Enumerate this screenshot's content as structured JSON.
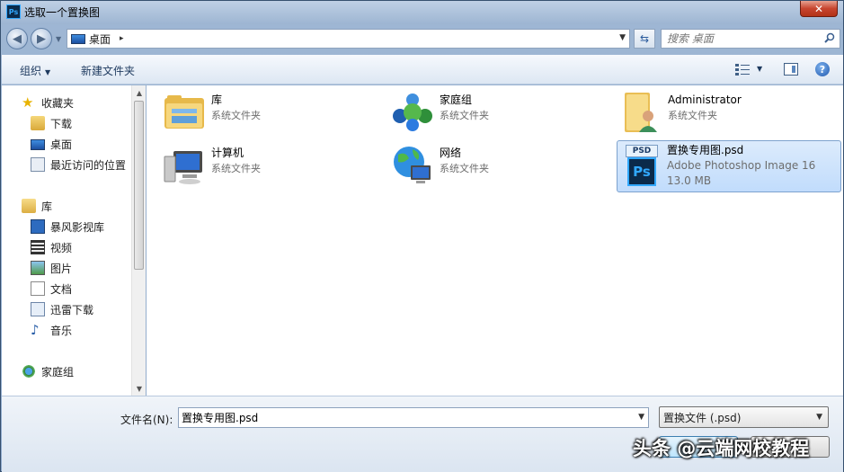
{
  "window": {
    "title": "选取一个置换图",
    "app_icon_text": "Ps",
    "close_glyph": "✕"
  },
  "address": {
    "back_glyph": "◀",
    "forward_glyph": "▶",
    "location": "桌面",
    "chevron": "▸",
    "search_placeholder": "搜索 桌面"
  },
  "toolbar": {
    "organize_label": "组织",
    "new_folder_label": "新建文件夹",
    "help_glyph": "?"
  },
  "nav": {
    "favorites_label": "收藏夹",
    "favorites": [
      "下载",
      "桌面",
      "最近访问的位置"
    ],
    "libraries_label": "库",
    "libraries": [
      "暴风影视库",
      "视频",
      "图片",
      "文档",
      "迅雷下载",
      "音乐"
    ],
    "homegroup_label": "家庭组"
  },
  "items": [
    {
      "name": "库",
      "sub": "系统文件夹"
    },
    {
      "name": "家庭组",
      "sub": "系统文件夹"
    },
    {
      "name": "Administrator",
      "sub": "系统文件夹"
    },
    {
      "name": "计算机",
      "sub": "系统文件夹"
    },
    {
      "name": "网络",
      "sub": "系统文件夹"
    },
    {
      "name": "置换专用图.psd",
      "sub": "Adobe Photoshop Image 16",
      "size": "13.0 MB",
      "icon_label": "PSD",
      "icon_logo": "Ps"
    }
  ],
  "bottom": {
    "filename_label": "文件名(N):",
    "filename_value": "置换专用图.psd",
    "filetype_value": "置换文件 (.psd)"
  },
  "watermark": "头条 @云端网校教程",
  "colors": {
    "selection_bg": "#c1dcfc",
    "ps_blue": "#31a8ff",
    "ps_dark": "#0b2a4a"
  }
}
